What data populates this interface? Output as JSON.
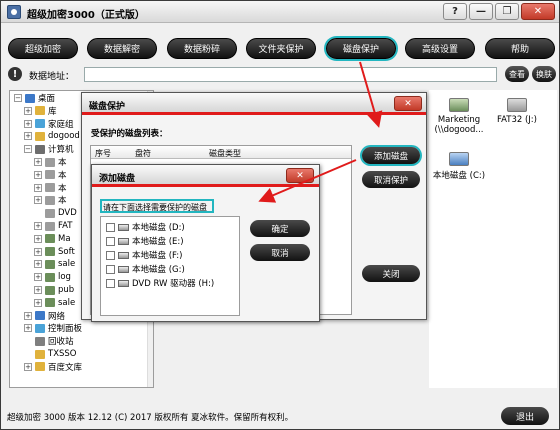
{
  "window": {
    "title": "超级加密3000（正式版）",
    "buttons": {
      "help": "?",
      "minimize": "—",
      "maximize": "❐",
      "close": "✕"
    }
  },
  "toolbar": {
    "items": [
      "超级加密",
      "数据解密",
      "数据粉碎",
      "文件夹保护",
      "磁盘保护",
      "高级设置",
      "帮助"
    ],
    "active": "磁盘保护"
  },
  "address": {
    "label": "数据地址：",
    "value": "",
    "view_button": "查看",
    "skin_button": "换肤"
  },
  "tree": {
    "items": [
      {
        "label": "桌面",
        "expander": "−"
      },
      {
        "label": "库",
        "expander": "+"
      },
      {
        "label": "家庭组",
        "expander": "+"
      },
      {
        "label": "dogood",
        "expander": "+"
      },
      {
        "label": "计算机",
        "expander": "−"
      },
      {
        "label": "本",
        "expander": "+"
      },
      {
        "label": "本",
        "expander": "+"
      },
      {
        "label": "本",
        "expander": "+"
      },
      {
        "label": "本",
        "expander": "+"
      },
      {
        "label": "DVD",
        "expander": ""
      },
      {
        "label": "FAT",
        "expander": "+"
      },
      {
        "label": "Ma",
        "expander": "+"
      },
      {
        "label": "Soft",
        "expander": "+"
      },
      {
        "label": "sale",
        "expander": "+"
      },
      {
        "label": "log",
        "expander": "+"
      },
      {
        "label": "pub",
        "expander": "+"
      },
      {
        "label": "sale",
        "expander": "+"
      },
      {
        "label": "网络",
        "expander": "+"
      },
      {
        "label": "控制面板",
        "expander": "+"
      },
      {
        "label": "回收站",
        "expander": ""
      },
      {
        "label": "TXSSO",
        "expander": ""
      },
      {
        "label": "百度文库",
        "expander": "+"
      }
    ]
  },
  "drives": [
    {
      "label": "Marketing (\\\\dogood...",
      "color": "#6b8e5a"
    },
    {
      "label": "FAT32 (J:)",
      "color": "#9a9a9a"
    },
    {
      "label": "本地磁盘 (C:)",
      "color": "#4a7fc1"
    }
  ],
  "status": {
    "text": "超级加密 3000 版本 12.12 (C) 2017 版权所有 夏冰软件。保留所有权利。",
    "exit_button": "退出"
  },
  "disk_protect_dialog": {
    "title": "磁盘保护",
    "close": "✕",
    "list_label": "受保护的磁盘列表：",
    "columns": [
      "序号",
      "盘符",
      "磁盘类型"
    ],
    "add_button": "添加磁盘",
    "cancel_button": "取消保护",
    "close_button": "关闭"
  },
  "add_disk_dialog": {
    "title": "添加磁盘",
    "close": "✕",
    "prompt": "请在下面选择需要保护的磁盘",
    "disks": [
      "本地磁盘 (D:)",
      "本地磁盘 (E:)",
      "本地磁盘 (F:)",
      "本地磁盘 (G:)",
      "DVD RW 驱动器 (H:)"
    ],
    "ok_button": "确定",
    "cancel_button": "取消"
  },
  "colors": {
    "accent_red": "#e01b1b",
    "highlight_cyan": "#23b6c0",
    "button_dark": "#111111"
  }
}
